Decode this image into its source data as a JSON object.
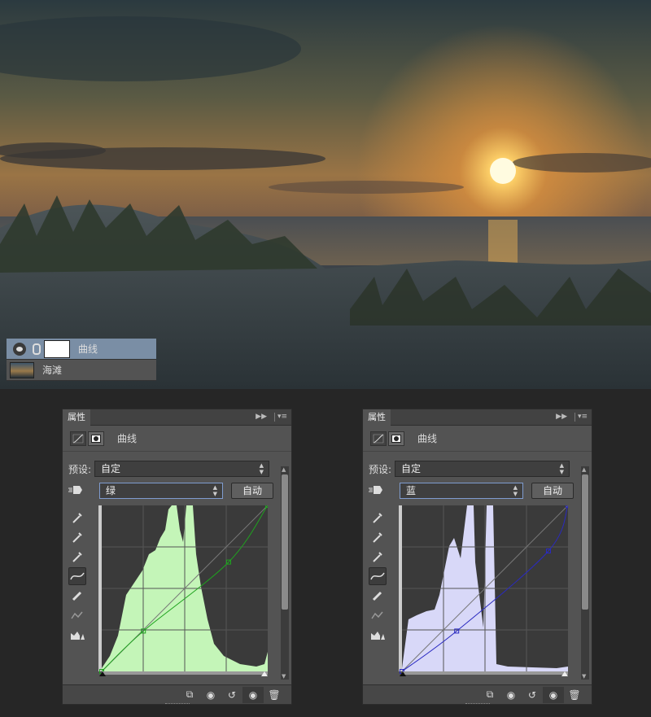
{
  "layers": [
    {
      "name": "曲线",
      "selected": true,
      "type": "adjustment"
    },
    {
      "name": "海滩",
      "selected": false,
      "type": "image"
    }
  ],
  "panels": [
    {
      "tab": "属性",
      "title": "曲线",
      "preset_label": "预设:",
      "preset_value": "自定",
      "channel": "绿",
      "auto_label": "自动",
      "channel_color": "#1fa31f",
      "histogram_color": "#c4f5b8",
      "curve_points": [
        [
          0,
          0
        ],
        [
          64,
          62
        ],
        [
          195,
          168
        ],
        [
          255,
          255
        ]
      ]
    },
    {
      "tab": "属性",
      "title": "曲线",
      "preset_label": "预设:",
      "preset_value": "自定",
      "channel": "蓝",
      "auto_label": "自动",
      "channel_color": "#2a2ac0",
      "histogram_color": "#d8d8f8",
      "curve_points": [
        [
          0,
          0
        ],
        [
          84,
          62
        ],
        [
          225,
          185
        ],
        [
          255,
          255
        ]
      ]
    }
  ],
  "icons": {
    "collapse": "double-arrow-icon",
    "menu": "panel-menu-icon",
    "clip": "clip-to-layer-icon",
    "view_prev": "view-previous-icon",
    "reset": "reset-icon",
    "visibility": "eye-icon",
    "delete": "trash-icon"
  }
}
